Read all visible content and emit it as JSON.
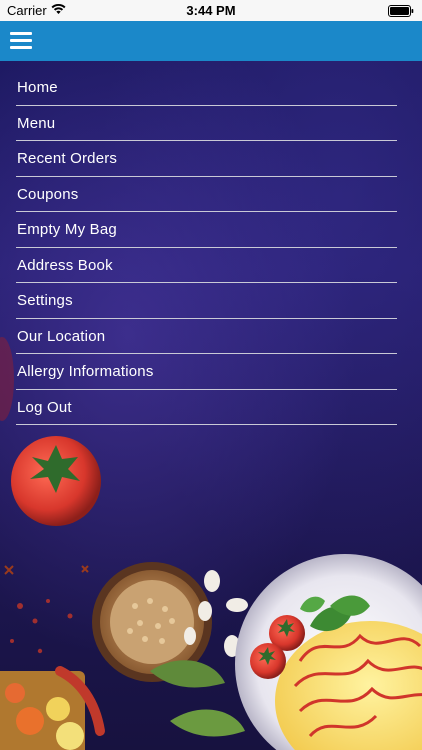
{
  "status_bar": {
    "carrier": "Carrier",
    "time": "3:44 PM",
    "wifi_icon": "wifi-icon",
    "battery_icon": "battery-icon"
  },
  "nav_bar": {
    "background_color": "#1b88c9",
    "menu_icon": "hamburger-menu-icon"
  },
  "menu": {
    "items": [
      {
        "label": "Home"
      },
      {
        "label": "Menu"
      },
      {
        "label": "Recent Orders"
      },
      {
        "label": "Coupons"
      },
      {
        "label": "Empty My Bag"
      },
      {
        "label": "Address Book"
      },
      {
        "label": "Settings"
      },
      {
        "label": "Our Location"
      },
      {
        "label": "Allergy Informations"
      },
      {
        "label": "Log Out"
      }
    ]
  },
  "theme": {
    "menu_text_color": "#ffffff",
    "divider_color": "#c9c9d6",
    "background_color": "#1e1a63"
  }
}
